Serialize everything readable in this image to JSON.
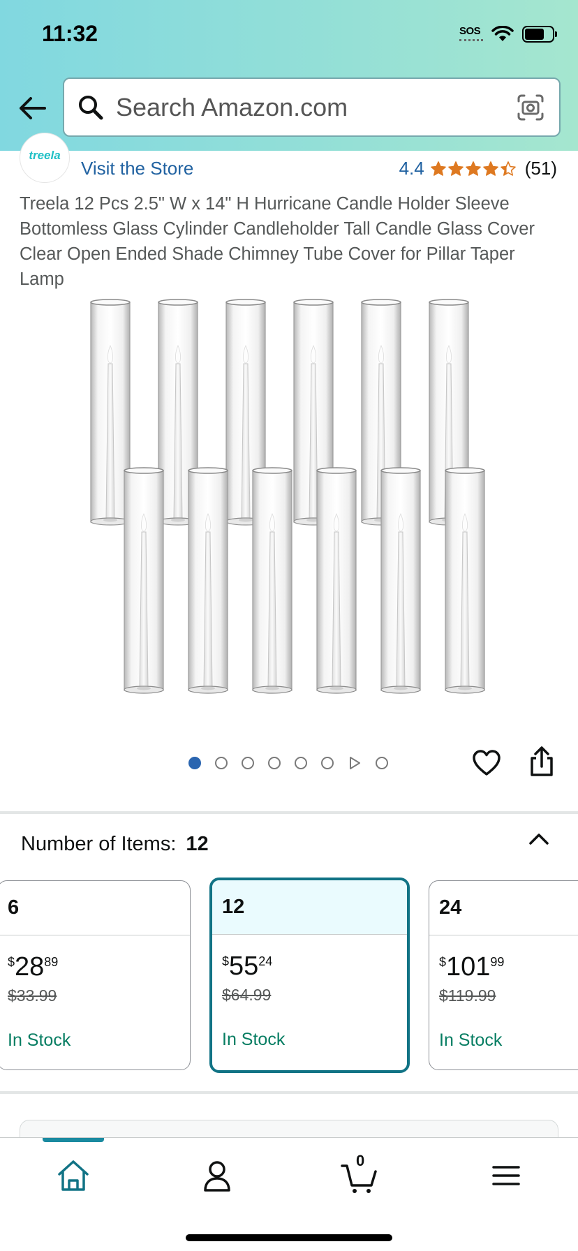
{
  "status_bar": {
    "time": "11:32",
    "sos": "SOS"
  },
  "search": {
    "placeholder": "Search Amazon.com"
  },
  "store": {
    "logo_text": "treela",
    "visit_label": "Visit the Store"
  },
  "rating": {
    "value": "4.4",
    "stars": 4.4,
    "count": "(51)",
    "star_color": "#de7921"
  },
  "product": {
    "title": "Treela 12 Pcs 2.5\" W x 14\" H Hurricane Candle Holder Sleeve Bottomless Glass Cylinder Candleholder Tall Candle Glass Cover Clear Open Ended Shade Chimney Tube Cover for Pillar Taper Lamp"
  },
  "gallery": {
    "total": 8,
    "active_index": 0,
    "video_index": 6
  },
  "variation": {
    "label": "Number of Items:",
    "selected_value": "12",
    "options": [
      {
        "count": "6",
        "symbol": "$",
        "price_whole": "28",
        "price_fraction": "89",
        "list_price": "$33.99",
        "stock": "In Stock"
      },
      {
        "count": "12",
        "symbol": "$",
        "price_whole": "55",
        "price_fraction": "24",
        "list_price": "$64.99",
        "stock": "In Stock"
      },
      {
        "count": "24",
        "symbol": "$",
        "price_whole": "101",
        "price_fraction": "99",
        "list_price": "$119.99",
        "stock": "In Stock"
      }
    ]
  },
  "bottom_nav": {
    "items": [
      "home-icon",
      "account-icon",
      "cart-icon",
      "menu-icon"
    ],
    "cart_count": "0",
    "active": "home"
  },
  "colors": {
    "accent": "#117385",
    "link": "#2162a1",
    "in_stock": "#067d62"
  }
}
